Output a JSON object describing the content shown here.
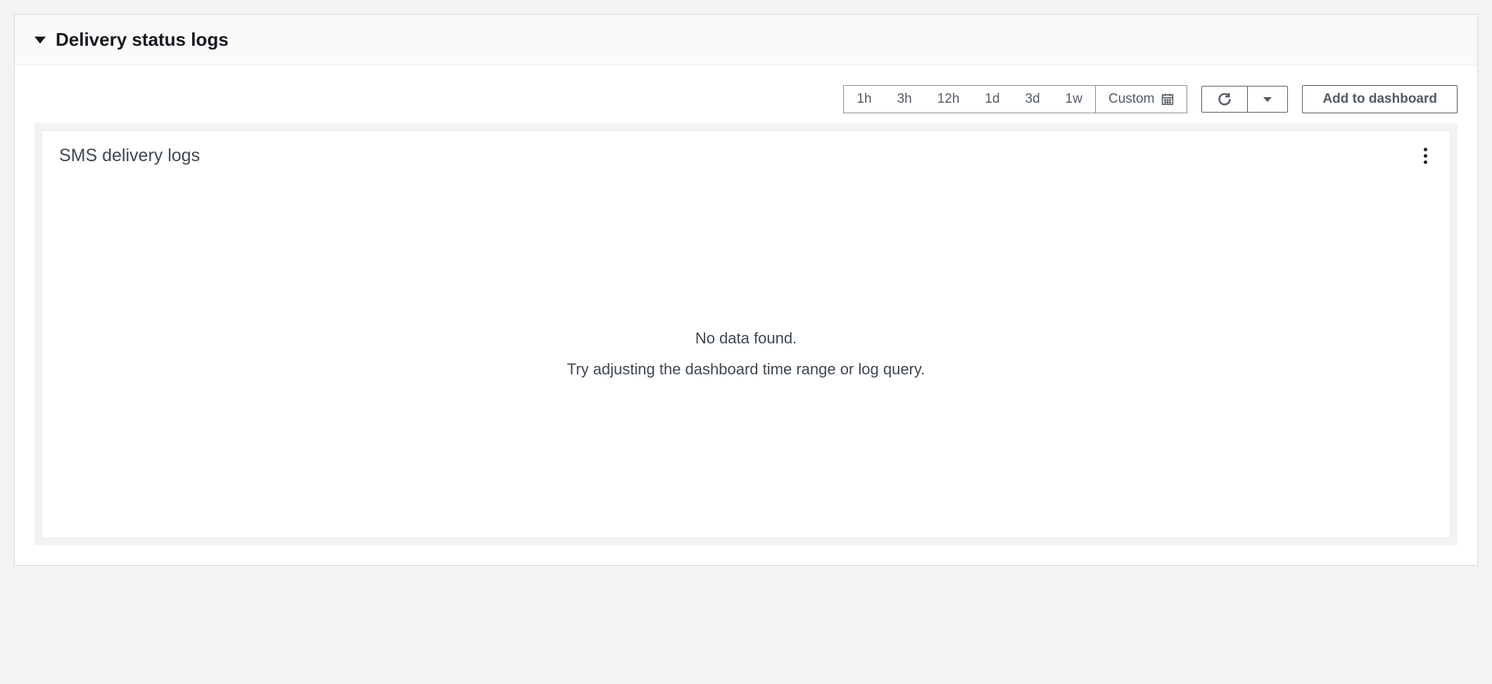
{
  "panel": {
    "title": "Delivery status logs"
  },
  "time_ranges": [
    "1h",
    "3h",
    "12h",
    "1d",
    "3d",
    "1w"
  ],
  "custom_label": "Custom",
  "buttons": {
    "add_to_dashboard": "Add to dashboard"
  },
  "chart": {
    "title": "SMS delivery logs",
    "empty_primary": "No data found.",
    "empty_secondary": "Try adjusting the dashboard time range or log query."
  }
}
